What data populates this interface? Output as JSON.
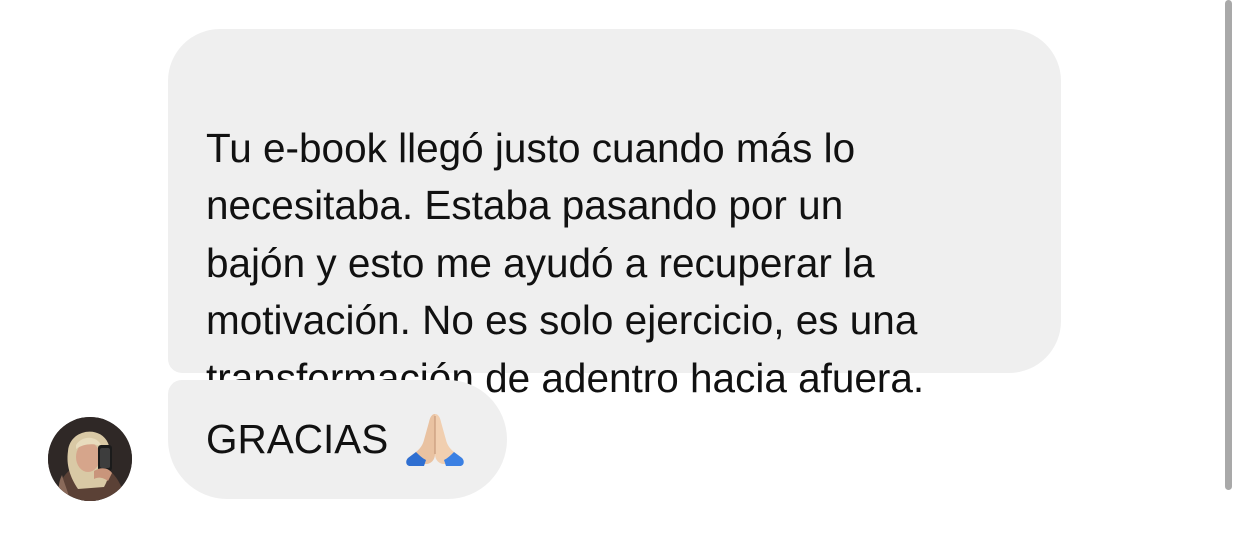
{
  "messages": [
    {
      "text": "Tu e-book llegó justo cuando más lo\nnecesitaba. Estaba pasando por un\nbajón y esto me ayudó a recuperar la\nmotivación. No es solo ejercicio, es una\ntransformación de adentro hacia afuera."
    },
    {
      "text": "GRACIAS",
      "icon": "praying-hands-icon"
    }
  ],
  "colors": {
    "bubble": "#efefef",
    "text": "#111111",
    "background": "#ffffff",
    "scrollbar": "#a9a9a9"
  }
}
